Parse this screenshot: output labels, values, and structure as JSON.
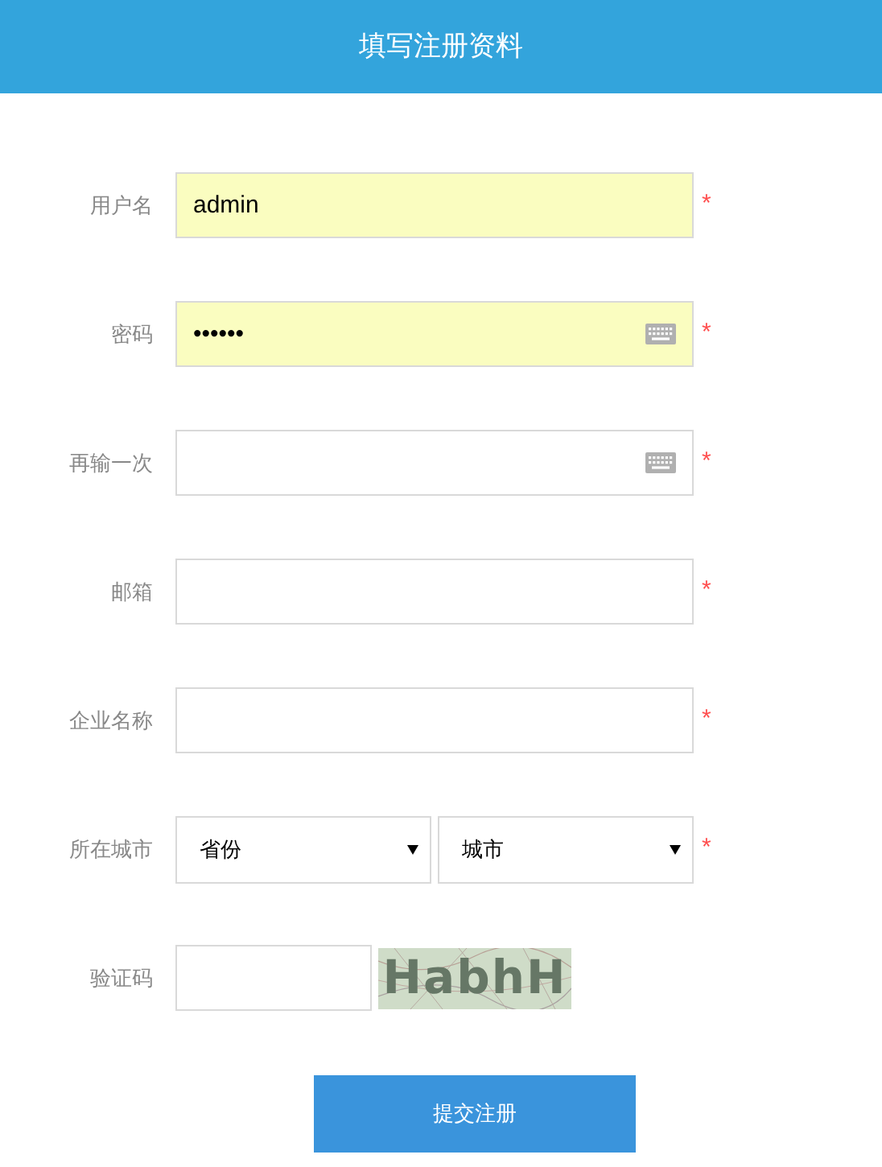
{
  "header": {
    "title": "填写注册资料"
  },
  "fields": [
    {
      "kind": "text",
      "label": "用户名",
      "value": "admin",
      "autofilled": true,
      "keyboard": false,
      "required": true
    },
    {
      "kind": "text",
      "label": "密码",
      "value": "••••••",
      "autofilled": true,
      "keyboard": true,
      "required": true
    },
    {
      "kind": "text",
      "label": "再输一次",
      "autofilled": false,
      "keyboard": true,
      "required": true
    },
    {
      "kind": "text",
      "label": "邮箱",
      "autofilled": false,
      "keyboard": false,
      "required": true
    },
    {
      "kind": "text",
      "label": "企业名称",
      "autofilled": false,
      "keyboard": false,
      "required": true
    },
    {
      "kind": "selects",
      "label": "所在城市",
      "options": [
        "省份",
        "城市"
      ],
      "required": true
    },
    {
      "kind": "captcha",
      "label": "验证码",
      "captcha": "HabhH",
      "required": false
    }
  ],
  "required_mark": "*",
  "submit": "提交注册"
}
